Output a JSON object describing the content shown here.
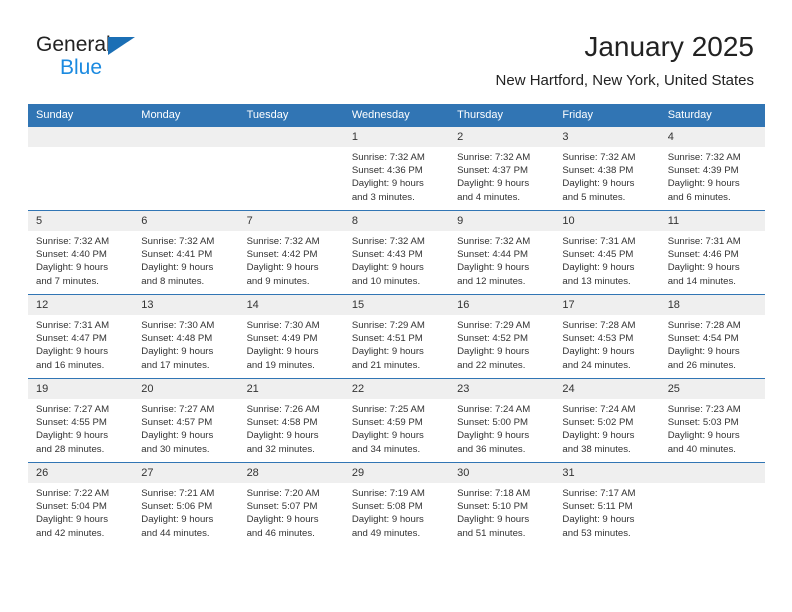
{
  "brand": {
    "name_line1": "General",
    "name_line2": "Blue",
    "triangle_color": "#1b6fb5",
    "blue_color": "#1b8ae0"
  },
  "header": {
    "title": "January 2025",
    "subtitle": "New Hartford, New York, United States",
    "accent_color": "#3175b4"
  },
  "weekday_headers": [
    "Sunday",
    "Monday",
    "Tuesday",
    "Wednesday",
    "Thursday",
    "Friday",
    "Saturday"
  ],
  "weeks": [
    [
      {
        "day": "",
        "sunrise": "",
        "sunset": "",
        "daylight1": "",
        "daylight2": ""
      },
      {
        "day": "",
        "sunrise": "",
        "sunset": "",
        "daylight1": "",
        "daylight2": ""
      },
      {
        "day": "",
        "sunrise": "",
        "sunset": "",
        "daylight1": "",
        "daylight2": ""
      },
      {
        "day": "1",
        "sunrise": "Sunrise: 7:32 AM",
        "sunset": "Sunset: 4:36 PM",
        "daylight1": "Daylight: 9 hours",
        "daylight2": "and 3 minutes."
      },
      {
        "day": "2",
        "sunrise": "Sunrise: 7:32 AM",
        "sunset": "Sunset: 4:37 PM",
        "daylight1": "Daylight: 9 hours",
        "daylight2": "and 4 minutes."
      },
      {
        "day": "3",
        "sunrise": "Sunrise: 7:32 AM",
        "sunset": "Sunset: 4:38 PM",
        "daylight1": "Daylight: 9 hours",
        "daylight2": "and 5 minutes."
      },
      {
        "day": "4",
        "sunrise": "Sunrise: 7:32 AM",
        "sunset": "Sunset: 4:39 PM",
        "daylight1": "Daylight: 9 hours",
        "daylight2": "and 6 minutes."
      }
    ],
    [
      {
        "day": "5",
        "sunrise": "Sunrise: 7:32 AM",
        "sunset": "Sunset: 4:40 PM",
        "daylight1": "Daylight: 9 hours",
        "daylight2": "and 7 minutes."
      },
      {
        "day": "6",
        "sunrise": "Sunrise: 7:32 AM",
        "sunset": "Sunset: 4:41 PM",
        "daylight1": "Daylight: 9 hours",
        "daylight2": "and 8 minutes."
      },
      {
        "day": "7",
        "sunrise": "Sunrise: 7:32 AM",
        "sunset": "Sunset: 4:42 PM",
        "daylight1": "Daylight: 9 hours",
        "daylight2": "and 9 minutes."
      },
      {
        "day": "8",
        "sunrise": "Sunrise: 7:32 AM",
        "sunset": "Sunset: 4:43 PM",
        "daylight1": "Daylight: 9 hours",
        "daylight2": "and 10 minutes."
      },
      {
        "day": "9",
        "sunrise": "Sunrise: 7:32 AM",
        "sunset": "Sunset: 4:44 PM",
        "daylight1": "Daylight: 9 hours",
        "daylight2": "and 12 minutes."
      },
      {
        "day": "10",
        "sunrise": "Sunrise: 7:31 AM",
        "sunset": "Sunset: 4:45 PM",
        "daylight1": "Daylight: 9 hours",
        "daylight2": "and 13 minutes."
      },
      {
        "day": "11",
        "sunrise": "Sunrise: 7:31 AM",
        "sunset": "Sunset: 4:46 PM",
        "daylight1": "Daylight: 9 hours",
        "daylight2": "and 14 minutes."
      }
    ],
    [
      {
        "day": "12",
        "sunrise": "Sunrise: 7:31 AM",
        "sunset": "Sunset: 4:47 PM",
        "daylight1": "Daylight: 9 hours",
        "daylight2": "and 16 minutes."
      },
      {
        "day": "13",
        "sunrise": "Sunrise: 7:30 AM",
        "sunset": "Sunset: 4:48 PM",
        "daylight1": "Daylight: 9 hours",
        "daylight2": "and 17 minutes."
      },
      {
        "day": "14",
        "sunrise": "Sunrise: 7:30 AM",
        "sunset": "Sunset: 4:49 PM",
        "daylight1": "Daylight: 9 hours",
        "daylight2": "and 19 minutes."
      },
      {
        "day": "15",
        "sunrise": "Sunrise: 7:29 AM",
        "sunset": "Sunset: 4:51 PM",
        "daylight1": "Daylight: 9 hours",
        "daylight2": "and 21 minutes."
      },
      {
        "day": "16",
        "sunrise": "Sunrise: 7:29 AM",
        "sunset": "Sunset: 4:52 PM",
        "daylight1": "Daylight: 9 hours",
        "daylight2": "and 22 minutes."
      },
      {
        "day": "17",
        "sunrise": "Sunrise: 7:28 AM",
        "sunset": "Sunset: 4:53 PM",
        "daylight1": "Daylight: 9 hours",
        "daylight2": "and 24 minutes."
      },
      {
        "day": "18",
        "sunrise": "Sunrise: 7:28 AM",
        "sunset": "Sunset: 4:54 PM",
        "daylight1": "Daylight: 9 hours",
        "daylight2": "and 26 minutes."
      }
    ],
    [
      {
        "day": "19",
        "sunrise": "Sunrise: 7:27 AM",
        "sunset": "Sunset: 4:55 PM",
        "daylight1": "Daylight: 9 hours",
        "daylight2": "and 28 minutes."
      },
      {
        "day": "20",
        "sunrise": "Sunrise: 7:27 AM",
        "sunset": "Sunset: 4:57 PM",
        "daylight1": "Daylight: 9 hours",
        "daylight2": "and 30 minutes."
      },
      {
        "day": "21",
        "sunrise": "Sunrise: 7:26 AM",
        "sunset": "Sunset: 4:58 PM",
        "daylight1": "Daylight: 9 hours",
        "daylight2": "and 32 minutes."
      },
      {
        "day": "22",
        "sunrise": "Sunrise: 7:25 AM",
        "sunset": "Sunset: 4:59 PM",
        "daylight1": "Daylight: 9 hours",
        "daylight2": "and 34 minutes."
      },
      {
        "day": "23",
        "sunrise": "Sunrise: 7:24 AM",
        "sunset": "Sunset: 5:00 PM",
        "daylight1": "Daylight: 9 hours",
        "daylight2": "and 36 minutes."
      },
      {
        "day": "24",
        "sunrise": "Sunrise: 7:24 AM",
        "sunset": "Sunset: 5:02 PM",
        "daylight1": "Daylight: 9 hours",
        "daylight2": "and 38 minutes."
      },
      {
        "day": "25",
        "sunrise": "Sunrise: 7:23 AM",
        "sunset": "Sunset: 5:03 PM",
        "daylight1": "Daylight: 9 hours",
        "daylight2": "and 40 minutes."
      }
    ],
    [
      {
        "day": "26",
        "sunrise": "Sunrise: 7:22 AM",
        "sunset": "Sunset: 5:04 PM",
        "daylight1": "Daylight: 9 hours",
        "daylight2": "and 42 minutes."
      },
      {
        "day": "27",
        "sunrise": "Sunrise: 7:21 AM",
        "sunset": "Sunset: 5:06 PM",
        "daylight1": "Daylight: 9 hours",
        "daylight2": "and 44 minutes."
      },
      {
        "day": "28",
        "sunrise": "Sunrise: 7:20 AM",
        "sunset": "Sunset: 5:07 PM",
        "daylight1": "Daylight: 9 hours",
        "daylight2": "and 46 minutes."
      },
      {
        "day": "29",
        "sunrise": "Sunrise: 7:19 AM",
        "sunset": "Sunset: 5:08 PM",
        "daylight1": "Daylight: 9 hours",
        "daylight2": "and 49 minutes."
      },
      {
        "day": "30",
        "sunrise": "Sunrise: 7:18 AM",
        "sunset": "Sunset: 5:10 PM",
        "daylight1": "Daylight: 9 hours",
        "daylight2": "and 51 minutes."
      },
      {
        "day": "31",
        "sunrise": "Sunrise: 7:17 AM",
        "sunset": "Sunset: 5:11 PM",
        "daylight1": "Daylight: 9 hours",
        "daylight2": "and 53 minutes."
      },
      {
        "day": "",
        "sunrise": "",
        "sunset": "",
        "daylight1": "",
        "daylight2": ""
      }
    ]
  ]
}
